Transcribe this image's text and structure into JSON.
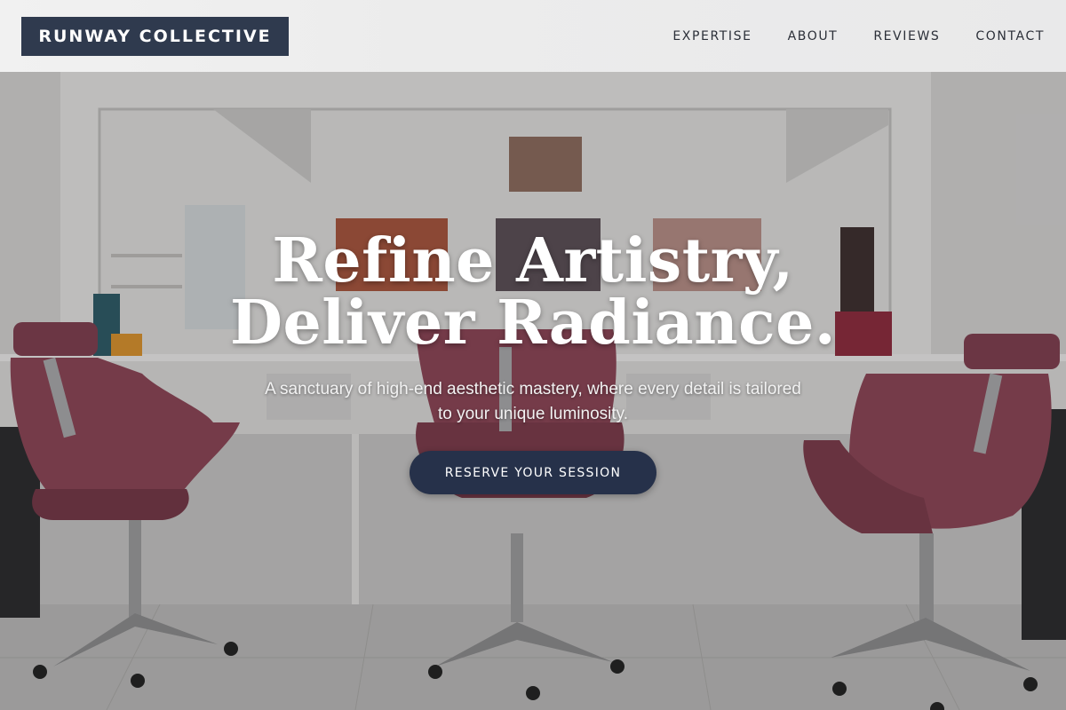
{
  "header": {
    "logo": "RUNWAY COLLECTIVE",
    "nav": [
      {
        "label": "EXPERTISE"
      },
      {
        "label": "ABOUT"
      },
      {
        "label": "REVIEWS"
      },
      {
        "label": "CONTACT"
      }
    ]
  },
  "hero": {
    "headline_line1": "Refine Artistry,",
    "headline_line2": "Deliver Radiance.",
    "subtext": "A sanctuary of high-end aesthetic mastery, where every detail is tailored to your unique luminosity.",
    "cta_label": "RESERVE YOUR SESSION",
    "background_image": "salon-interior-with-chairs-and-mirror"
  },
  "colors": {
    "logo_bg": "#2f3a4e",
    "cta_bg": "#26314a",
    "chair": "#8a4455",
    "header_bg": "#eeeeee"
  }
}
